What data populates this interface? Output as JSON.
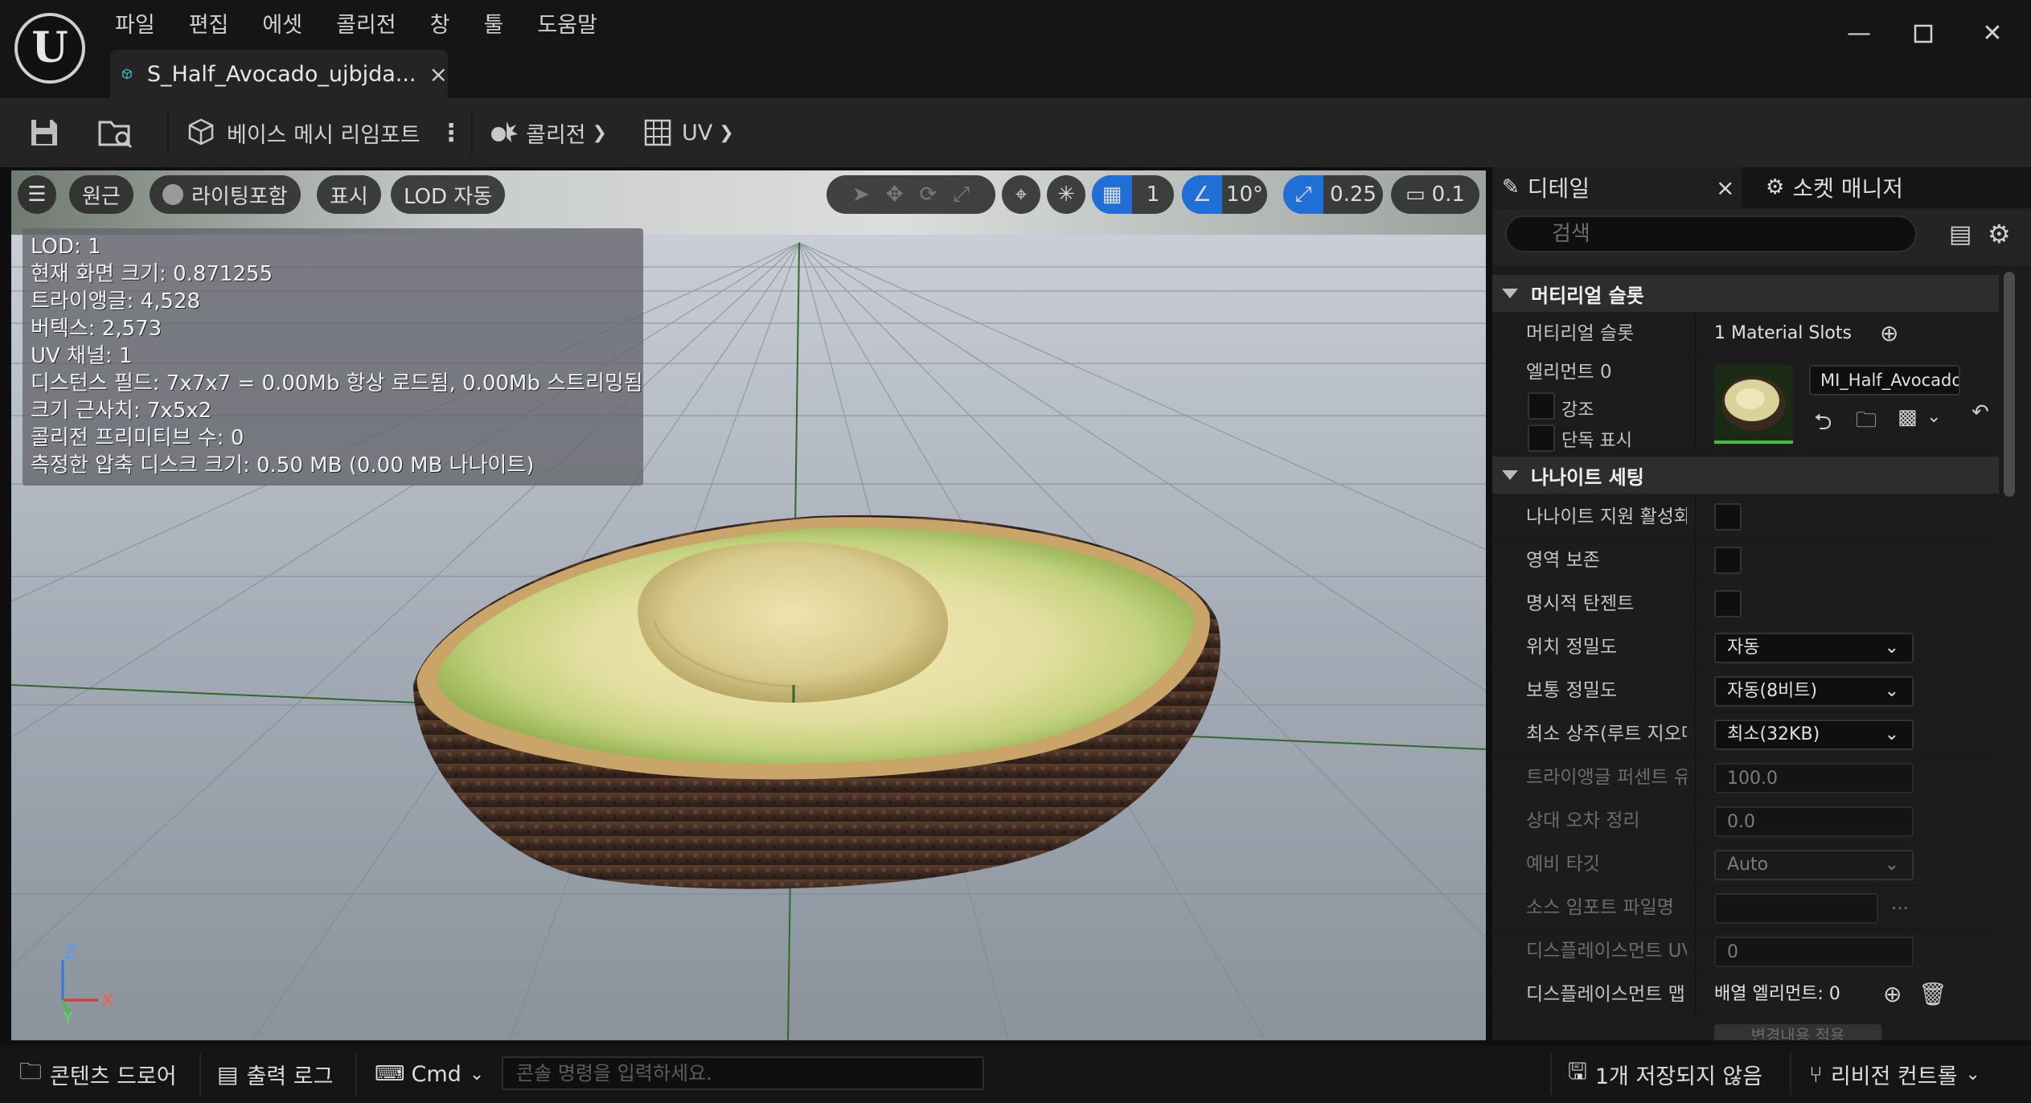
{
  "window": {
    "menu": [
      "파일",
      "편집",
      "에셋",
      "콜리전",
      "창",
      "툴",
      "도움말"
    ],
    "tab_title": "S_Half_Avocado_ujbjda...",
    "tab_close": "×"
  },
  "toolbar": {
    "reimport_label": "베이스 메시 리임포트",
    "collision_label": "콜리전",
    "uv_label": "UV"
  },
  "viewport": {
    "perspective_label": "원근",
    "lighting_label": "라이팅포함",
    "show_label": "표시",
    "lod_label": "LOD 자동",
    "grid_snap_value": "1",
    "rotation_snap_value": "10°",
    "scale_snap_value": "0.25",
    "camera_speed_value": "0.1",
    "stats": [
      "LOD:  1",
      "현재 화면 크기: 0.871255",
      "트라이앵글: 4,528",
      "버텍스: 2,573",
      "UV 채널:  1",
      "디스턴스 필드:  7x7x7 = 0.00Mb 항상 로드됨, 0.00Mb 스트리밍됨",
      "크기 근사치: 7x5x2",
      "콜리전 프리미티브 수: 0",
      "측정한 압축 디스크 크기: 0.50 MB (0.00 MB 나나이트)"
    ],
    "axis_labels": {
      "z": "Z",
      "x": "X",
      "y": "Y"
    }
  },
  "details": {
    "tab_details": "디테일",
    "tab_close": "×",
    "tab_sockets": "소켓 매니저",
    "search_placeholder": "검색",
    "material_section": "머티리얼 슬롯",
    "material_slots_label": "머티리얼 슬롯",
    "material_slots_value": "1 Material Slots",
    "element_label": "엘리먼트 0",
    "highlight_label": "강조",
    "isolate_label": "단독 표시",
    "material_name": "MI_Half_Avocado",
    "nanite_section": "나나이트 세팅",
    "properties": [
      {
        "label": "나나이트 지원 활성화",
        "type": "checkbox"
      },
      {
        "label": "영역 보존",
        "type": "checkbox"
      },
      {
        "label": "명시적 탄젠트",
        "type": "checkbox"
      },
      {
        "label": "위치 정밀도",
        "type": "combo",
        "value": "자동"
      },
      {
        "label": "보통 정밀도",
        "type": "combo",
        "value": "자동(8비트)"
      },
      {
        "label": "최소 상주(루트 지오메!",
        "type": "combo",
        "value": "최소(32KB)"
      },
      {
        "label": "트라이앵글 퍼센트 유지",
        "type": "number",
        "value": "100.0"
      },
      {
        "label": "상대 오차 정리",
        "type": "number",
        "value": "0.0"
      },
      {
        "label": "예비 타깃",
        "type": "combo",
        "value": "Auto"
      },
      {
        "label": "소스 임포트 파일명",
        "type": "text",
        "value": ""
      },
      {
        "label": "디스플레이스먼트 UV 채널",
        "type": "number",
        "value": "0"
      },
      {
        "label": "디스플레이스먼트 맵",
        "type": "array",
        "value": "배열 엘리먼트: 0"
      }
    ],
    "apply_changes_label": "변경내용 적용"
  },
  "statusbar": {
    "content_drawer": "콘텐츠 드로어",
    "output_log": "출력 로그",
    "cmd_label": "Cmd",
    "cmd_placeholder": "콘솔 명령을 입력하세요.",
    "unsaved_label": "1개 저장되지 않음",
    "revision_label": "리비전 컨트롤"
  }
}
